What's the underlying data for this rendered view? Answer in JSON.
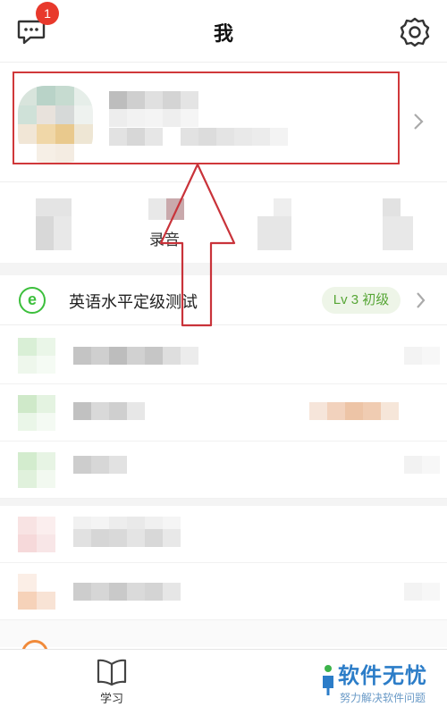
{
  "header": {
    "title": "我",
    "message_badge": "1",
    "message_icon": "chat-bubble-icon",
    "settings_icon": "gear-icon"
  },
  "profile": {
    "avatar": "avatar",
    "chevron_icon": "chevron-right-icon"
  },
  "stats": {
    "items": [
      {
        "label": ""
      },
      {
        "label": "录音"
      },
      {
        "label": ""
      },
      {
        "label": ""
      }
    ]
  },
  "level_test": {
    "icon": "e-circle-icon",
    "label": "英语水平定级测试",
    "level_badge": "Lv 3 初级",
    "chevron_icon": "chevron-right-icon"
  },
  "tabbar": {
    "study_label": "学习",
    "study_icon": "book-icon"
  },
  "watermark": {
    "title": "软件无忧",
    "subtitle": "努力解决软件问题"
  },
  "colors": {
    "accent_green": "#3cbf3c",
    "badge_red": "#e8392c",
    "highlight_red": "#d0383a",
    "watermark_blue": "#2c7dc8"
  }
}
